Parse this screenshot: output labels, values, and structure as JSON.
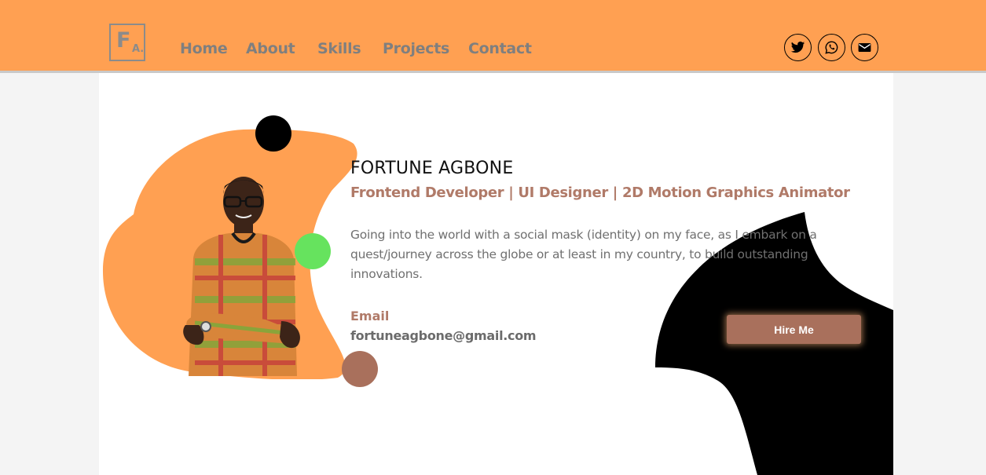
{
  "logo": {
    "big": "F",
    "small": "A."
  },
  "nav": [
    {
      "label": "Home"
    },
    {
      "label": "About"
    },
    {
      "label": "Skills"
    },
    {
      "label": "Projects"
    },
    {
      "label": "Contact"
    }
  ],
  "social": [
    {
      "icon": "twitter-icon"
    },
    {
      "icon": "whatsapp-icon"
    },
    {
      "icon": "envelope-icon"
    }
  ],
  "profile": {
    "name": "FORTUNE AGBONE",
    "role": "Frontend Developer | UI Designer | 2D Motion Graphics Animator",
    "bio": "Going into the world with a social mask (identity) on my face, as I embark on a quest/journey across the globe or at least in my country, to build outstanding innovations.",
    "email_label": "Email",
    "email": "fortuneagbone@gmail.com"
  },
  "hire_button": "Hire Me",
  "colors": {
    "header": "#ffa052",
    "accent_brown": "#a9705c",
    "accent_green": "#66e35e",
    "text_gray": "#7f7f7f"
  }
}
